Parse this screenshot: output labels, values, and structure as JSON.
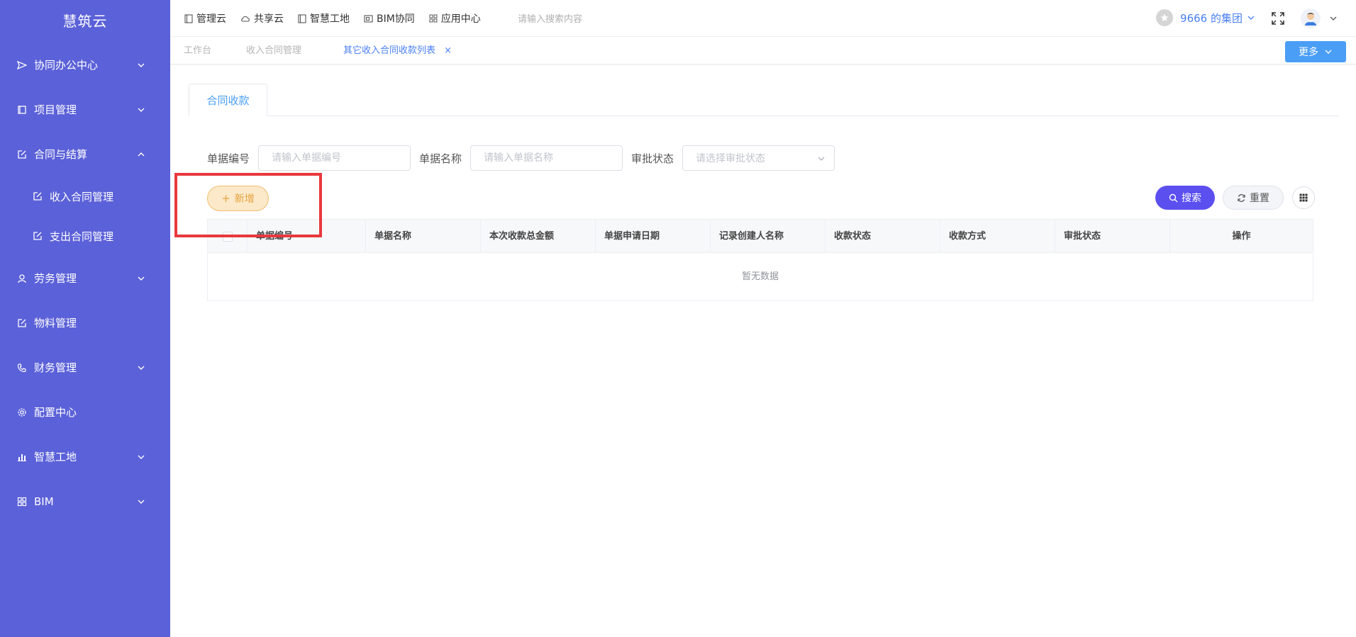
{
  "brand": "慧筑云",
  "sidebar": {
    "items": [
      {
        "label": "协同办公中心",
        "icon": "send-icon",
        "expanded": false
      },
      {
        "label": "项目管理",
        "icon": "book-icon",
        "expanded": false
      },
      {
        "label": "合同与结算",
        "icon": "edit-icon",
        "expanded": true,
        "children": [
          {
            "label": "收入合同管理",
            "icon": "edit-icon"
          },
          {
            "label": "支出合同管理",
            "icon": "edit-icon"
          }
        ]
      },
      {
        "label": "劳务管理",
        "icon": "user-icon",
        "expanded": false
      },
      {
        "label": "物料管理",
        "icon": "edit-icon",
        "expanded": null
      },
      {
        "label": "财务管理",
        "icon": "phone-icon",
        "expanded": false
      },
      {
        "label": "配置中心",
        "icon": "gear-icon",
        "expanded": null
      },
      {
        "label": "智慧工地",
        "icon": "bar-chart-icon",
        "expanded": false
      },
      {
        "label": "BIM",
        "icon": "grid-icon",
        "expanded": false
      }
    ]
  },
  "topnav": {
    "items": [
      {
        "label": "管理云",
        "icon": "book-icon"
      },
      {
        "label": "共享云",
        "icon": "cloud-icon"
      },
      {
        "label": "智慧工地",
        "icon": "book-icon"
      },
      {
        "label": "BIM协同",
        "icon": "folder-icon"
      },
      {
        "label": "应用中心",
        "icon": "grid-icon"
      }
    ],
    "search_placeholder": "请输入搜索内容",
    "group": "9666 的集团"
  },
  "tags": {
    "items": [
      {
        "label": "工作台",
        "active": false
      },
      {
        "label": "收入合同管理",
        "active": false
      },
      {
        "label": "其它收入合同收款列表",
        "active": true,
        "close": "×"
      }
    ],
    "more_label": "更多"
  },
  "main": {
    "tab_label": "合同收款",
    "filters": {
      "doc_no_label": "单据编号",
      "doc_no_placeholder": "请输入单据编号",
      "doc_name_label": "单据名称",
      "doc_name_placeholder": "请输入单据名称",
      "status_label": "审批状态",
      "status_placeholder": "请选择审批状态"
    },
    "add_label": "新增",
    "search_label": "搜索",
    "reset_label": "重置",
    "table": {
      "columns": [
        "单据编号",
        "单据名称",
        "本次收款总金额",
        "单据申请日期",
        "记录创建人名称",
        "收款状态",
        "收款方式",
        "审批状态",
        "操作"
      ],
      "empty_text": "暂无数据"
    }
  },
  "colors": {
    "sidebar_bg": "#5b61d8",
    "accent": "#4a9ef5",
    "primary_button": "#5b4ff0",
    "add_button_bg": "#fbe9c9",
    "add_button_text": "#e6a23c",
    "highlight_box": "#e8383d"
  }
}
